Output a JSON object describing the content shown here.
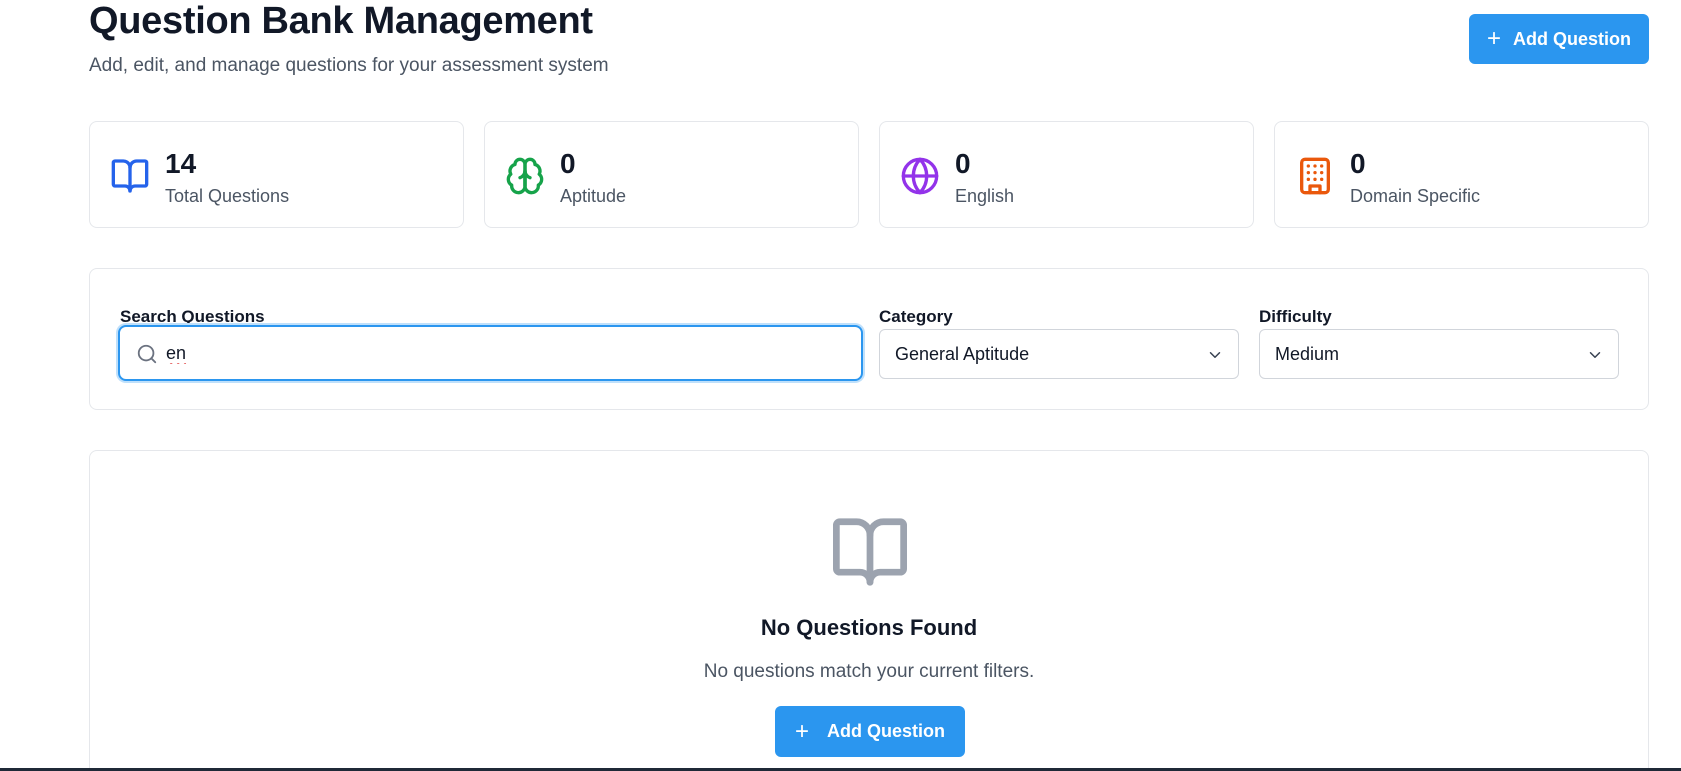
{
  "header": {
    "title": "Question Bank Management",
    "subtitle": "Add, edit, and manage questions for your assessment system",
    "add_button_label": "Add Question"
  },
  "stats": [
    {
      "value": "14",
      "label": "Total Questions",
      "icon": "book-open-icon",
      "color": "#2563eb"
    },
    {
      "value": "0",
      "label": "Aptitude",
      "icon": "brain-icon",
      "color": "#16a34a"
    },
    {
      "value": "0",
      "label": "English",
      "icon": "globe-icon",
      "color": "#9333ea"
    },
    {
      "value": "0",
      "label": "Domain Specific",
      "icon": "building-icon",
      "color": "#ea580c"
    }
  ],
  "filters": {
    "search_label": "Search Questions",
    "search_value": "en",
    "category_label": "Category",
    "category_value": "General Aptitude",
    "difficulty_label": "Difficulty",
    "difficulty_value": "Medium"
  },
  "empty_state": {
    "icon": "book-open-icon",
    "title": "No Questions Found",
    "message": "No questions match your current filters.",
    "button_label": "Add Question"
  },
  "colors": {
    "primary": "#2b96ef",
    "text": "#111827",
    "muted": "#4b5563",
    "border": "#e5e7eb"
  }
}
